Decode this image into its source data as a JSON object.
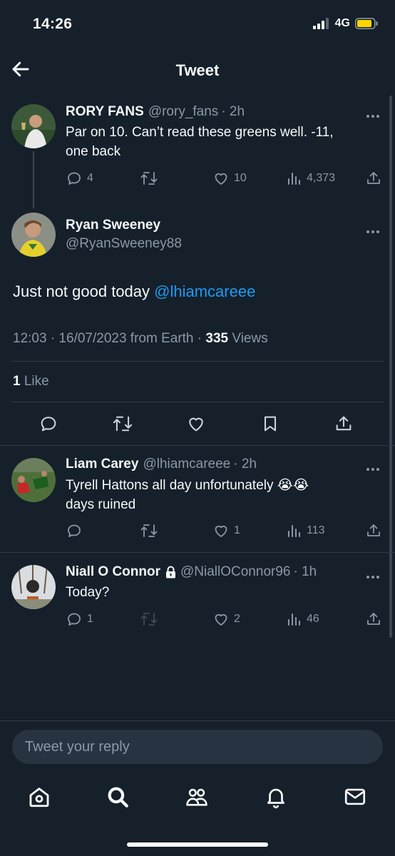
{
  "status_bar": {
    "time": "14:26",
    "network": "4G"
  },
  "header": {
    "title": "Tweet"
  },
  "parent_tweet": {
    "name": "RORY FANS",
    "handle": "@rory_fans",
    "age": "· 2h",
    "text_lines": [
      "Par on 10. Can’t read these greens well. -11,",
      "one back"
    ],
    "replies": "4",
    "likes": "10",
    "views": "4,373"
  },
  "main_tweet": {
    "name": "Ryan Sweeney",
    "handle": "@RyanSweeney88",
    "text": "Just not good today ",
    "mention": "@lhiamcareee",
    "time": "12:03 · 16/07/2023 from Earth · ",
    "views_count": "335",
    "views_label": " Views",
    "like_count": "1",
    "like_label": " Like"
  },
  "replies": [
    {
      "name": "Liam Carey",
      "handle": "@lhiamcareee",
      "age": "· 2h",
      "text_lines": [
        "Tyrell Hattons all day unfortunately 😭😭",
        "days ruined"
      ],
      "replies": "",
      "likes": "1",
      "views": "113"
    },
    {
      "name": "Niall O Connor",
      "handle": "@NiallOConnor96",
      "age": "· 1h",
      "text_lines": [
        "Today?"
      ],
      "replies": "1",
      "likes": "2",
      "views": "46"
    }
  ],
  "composer": {
    "placeholder": "Tweet your reply"
  },
  "colors": {
    "background": "#15202b",
    "muted": "#8b98a5",
    "link": "#1d9bf0",
    "battery": "#ffd400"
  },
  "icons": [
    "back-arrow-icon",
    "reply-icon",
    "retweet-icon",
    "like-icon",
    "views-icon",
    "share-icon",
    "bookmark-icon",
    "more-icon",
    "lock-icon",
    "home-icon",
    "search-icon",
    "communities-icon",
    "notifications-icon",
    "messages-icon"
  ]
}
